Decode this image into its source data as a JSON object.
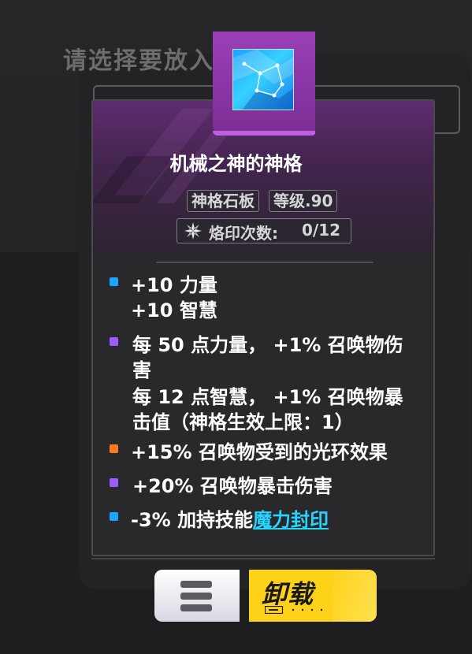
{
  "background": {
    "title": "请选择要放入的石板"
  },
  "item": {
    "name": "机械之神的神格",
    "type_tag": "神格石板",
    "level_tag": "等级.90",
    "imprint_label": "烙印次数:",
    "imprint_value": "0/12",
    "icon": "crystal-tablet-icon"
  },
  "stats": [
    {
      "color": "#1aa3ff",
      "lines": [
        "+10 力量",
        "+10 智慧"
      ]
    },
    {
      "color": "#9d5cff",
      "lines": [
        "每 50 点力量， +1% 召唤物伤",
        "害",
        "每 12 点智慧， +1% 召唤物暴",
        "击值（神格生效上限：1）"
      ]
    },
    {
      "color": "#ff7a1a",
      "lines": [
        "+15% 召唤物受到的光环效果"
      ]
    },
    {
      "color": "#9d5cff",
      "lines": [
        "+20% 召唤物暴击伤害"
      ]
    },
    {
      "color": "#1aa3ff",
      "prefix": "-3% 加持技能",
      "link": "魔力封印"
    }
  ],
  "buttons": {
    "menu_icon": "menu-icon",
    "unload_label": "卸载"
  },
  "colors": {
    "accent_purple": "#9b3fb8",
    "button_yellow": "#ffd21a",
    "link_cyan": "#27d4ff"
  }
}
